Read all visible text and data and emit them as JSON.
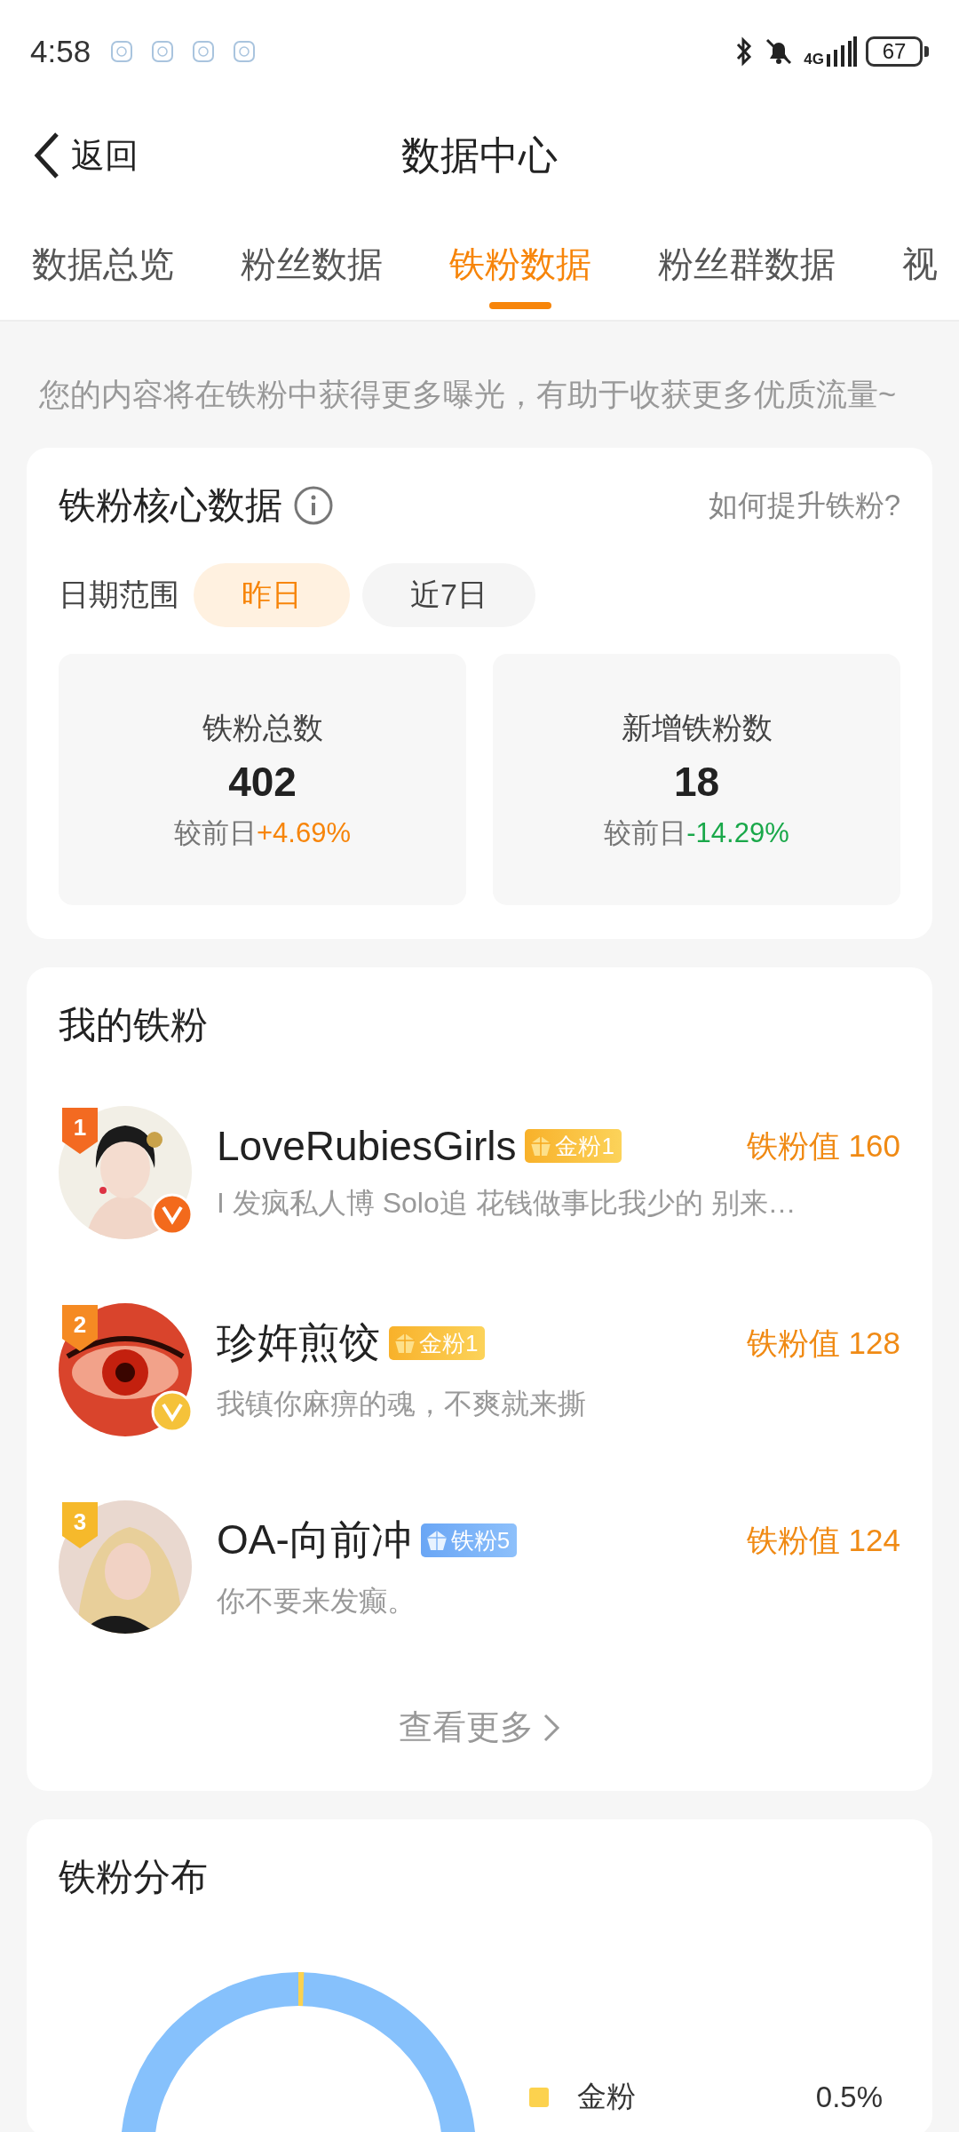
{
  "status_bar": {
    "time": "4:58",
    "network": "4G",
    "battery": "67"
  },
  "header": {
    "back": "返回",
    "title": "数据中心"
  },
  "tabs": [
    {
      "label": "数据总览",
      "selected": false
    },
    {
      "label": "粉丝数据",
      "selected": false
    },
    {
      "label": "铁粉数据",
      "selected": true
    },
    {
      "label": "粉丝群数据",
      "selected": false
    },
    {
      "label": "视",
      "selected": false
    }
  ],
  "hint": "您的内容将在铁粉中获得更多曝光，有助于收获更多优质流量~",
  "core": {
    "title": "铁粉核心数据",
    "help_link": "如何提升铁粉?",
    "date_label": "日期范围",
    "ranges": [
      {
        "label": "昨日",
        "selected": true
      },
      {
        "label": "近7日",
        "selected": false
      }
    ],
    "stats": [
      {
        "label": "铁粉总数",
        "value": "402",
        "compare_label": "较前日",
        "change": "+4.69%",
        "color": "#f7850a"
      },
      {
        "label": "新增铁粉数",
        "value": "18",
        "compare_label": "较前日",
        "change": "-14.29%",
        "color": "#1aa84a"
      }
    ]
  },
  "my_fans": {
    "title": "我的铁粉",
    "fans": [
      {
        "rank": {
          "text": "1",
          "color": "#f36a21"
        },
        "verified": {
          "color": "#f36a1c"
        },
        "name": "LoveRubiesGirls",
        "badge": {
          "kind": "gold",
          "label": "金粉1"
        },
        "score": "铁粉值 160",
        "bio": "I 发疯私人博 Solo追 花钱做事比我少的 别来…"
      },
      {
        "rank": {
          "text": "2",
          "color": "#f58a23"
        },
        "verified": {
          "color": "#f5c23a"
        },
        "name": "珍姩煎饺",
        "badge": {
          "kind": "gold",
          "label": "金粉1"
        },
        "score": "铁粉值 128",
        "bio": "我镇你麻痹的魂，不爽就来撕"
      },
      {
        "rank": {
          "text": "3",
          "color": "#f6b92b"
        },
        "name": "OA-向前冲",
        "badge": {
          "kind": "iron",
          "label": "铁粉5"
        },
        "score": "铁粉值 124",
        "bio": "你不要来发癫。"
      }
    ],
    "more": "查看更多"
  },
  "distribution": {
    "title": "铁粉分布",
    "legend": [
      {
        "label": "金粉",
        "value": "0.5%",
        "color": "#fcd24e"
      }
    ]
  }
}
